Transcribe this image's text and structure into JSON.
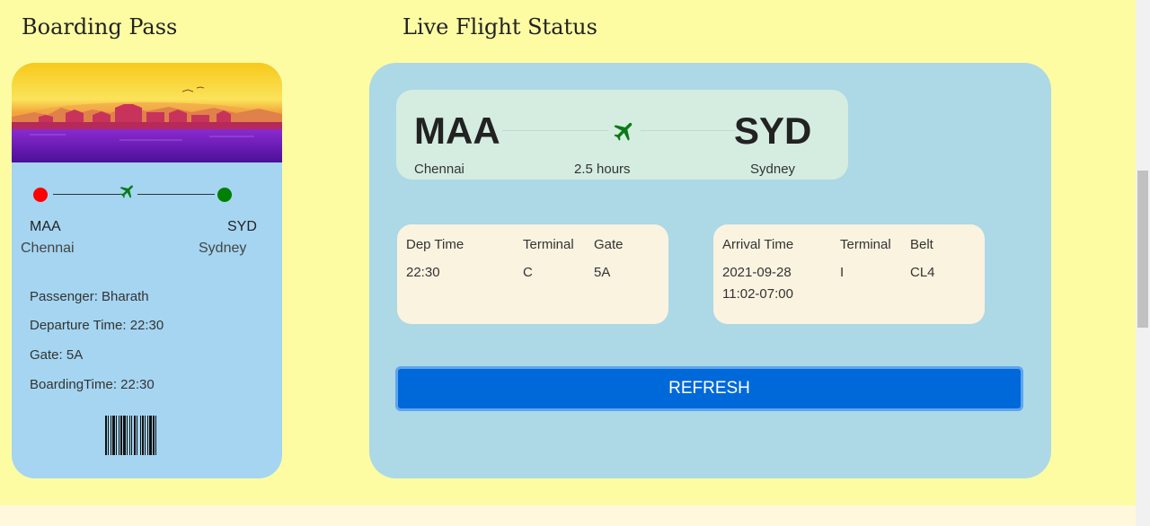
{
  "boarding_pass": {
    "title": "Boarding Pass",
    "from_code": "MAA",
    "from_city": "Chennai",
    "to_code": "SYD",
    "to_city": "Sydney",
    "passenger": "Passenger: Bharath",
    "departure_time": "Departure Time: 22:30",
    "gate": "Gate: 5A",
    "boarding_time": "BoardingTime: 22:30",
    "icons": {
      "plane": "plane-icon",
      "barcode": "barcode"
    }
  },
  "live_status": {
    "title": "Live Flight Status",
    "from_code": "MAA",
    "from_city": "Chennai",
    "duration": "2.5 hours",
    "to_code": "SYD",
    "to_city": "Sydney",
    "departure": {
      "headers": [
        "Dep Time",
        "Terminal",
        "Gate"
      ],
      "values": [
        "22:30",
        "C",
        "5A"
      ]
    },
    "arrival": {
      "headers": [
        "Arrival Time",
        "Terminal",
        "Belt"
      ],
      "values": [
        "2021-09-28\n11:02-07:00",
        "I",
        "CL4"
      ]
    },
    "refresh_label": "REFRESH"
  },
  "colors": {
    "page_bg": "#fdfca3",
    "boarding_card": "#a5d5f1",
    "status_card": "#add8e6",
    "route_box": "#d4ede0",
    "info_box": "#faf3e0",
    "refresh_button": "#0069d9",
    "plane": "#0a7a17",
    "origin_dot": "#ff0000",
    "destination_dot": "#008000"
  }
}
